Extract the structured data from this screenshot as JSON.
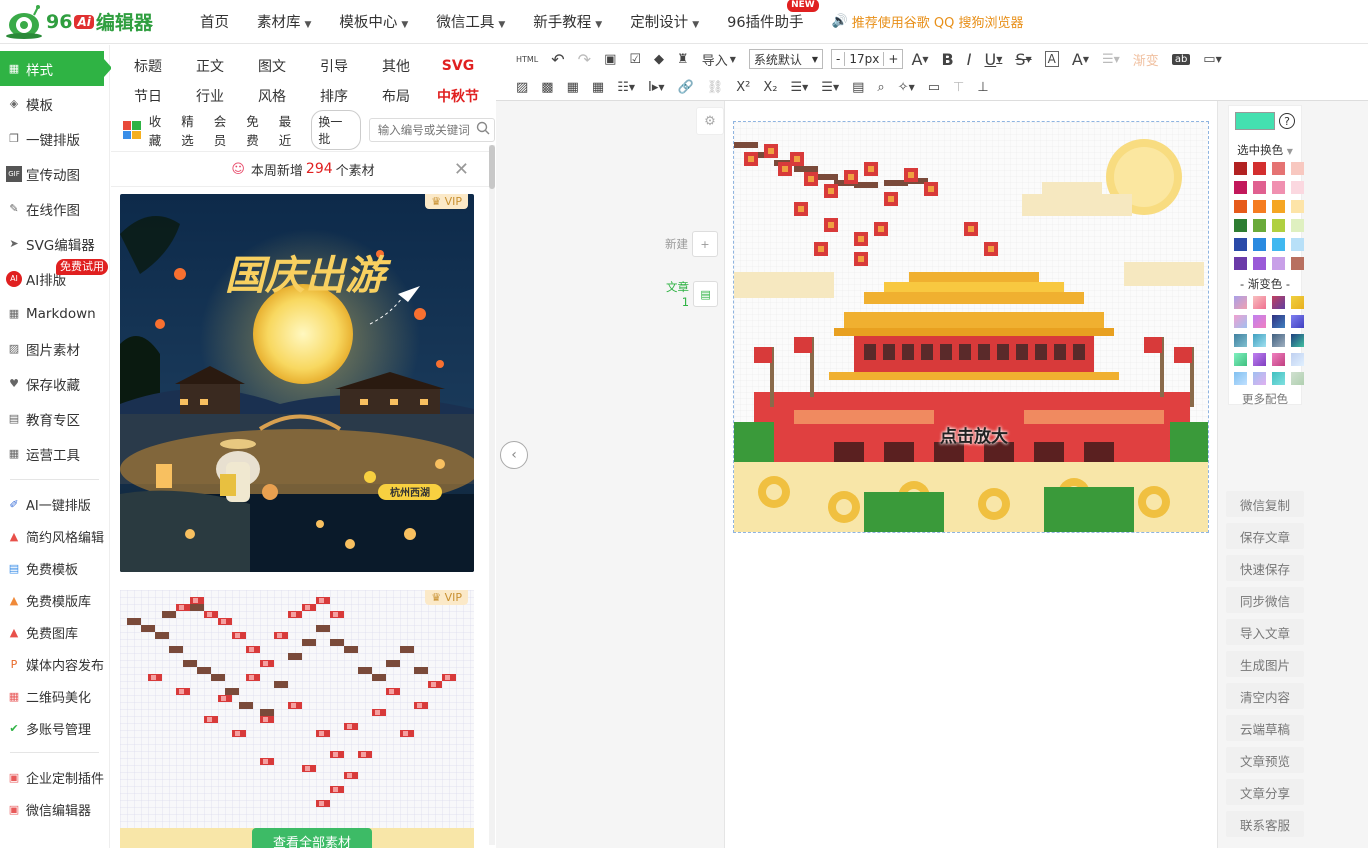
{
  "logo": {
    "prefix": "96",
    "ai": "Ai",
    "name": "编辑器"
  },
  "nav": {
    "items": [
      {
        "label": "首页",
        "caret": false
      },
      {
        "label": "素材库",
        "caret": true
      },
      {
        "label": "模板中心",
        "caret": true
      },
      {
        "label": "微信工具",
        "caret": true
      },
      {
        "label": "新手教程",
        "caret": true
      },
      {
        "label": "定制设计",
        "caret": true
      },
      {
        "label": "96插件助手",
        "caret": false
      }
    ],
    "new_badge": "NEW",
    "promo": "推荐使用谷歌 QQ 搜狗浏览器"
  },
  "sidebar": {
    "items": [
      {
        "label": "样式",
        "icon": "grid-icon",
        "active": true
      },
      {
        "label": "模板",
        "icon": "layers-icon"
      },
      {
        "label": "一键排版",
        "icon": "copy-icon"
      },
      {
        "label": "宣传动图",
        "icon": "gif-icon"
      },
      {
        "label": "在线作图",
        "icon": "edit-icon"
      },
      {
        "label": "SVG编辑器",
        "icon": "cursor-icon"
      },
      {
        "label": "AI排版",
        "icon": "ai-icon",
        "badge": "免费试用"
      },
      {
        "label": "Markdown",
        "icon": "grid-icon"
      },
      {
        "label": "图片素材",
        "icon": "image-icon"
      },
      {
        "label": "保存收藏",
        "icon": "heart-icon"
      },
      {
        "label": "教育专区",
        "icon": "book-icon"
      },
      {
        "label": "运营工具",
        "icon": "grid-icon"
      }
    ],
    "tools": [
      {
        "label": "AI一键排版",
        "icon": "ai-brush-icon",
        "color": "#3a6fd8"
      },
      {
        "label": "简约风格编辑",
        "icon": "picture-icon",
        "color": "#e8504a"
      },
      {
        "label": "免费模板",
        "icon": "doc-icon",
        "color": "#3a8ee8"
      },
      {
        "label": "免费模版库",
        "icon": "picture-icon",
        "color": "#f08a3a"
      },
      {
        "label": "免费图库",
        "icon": "picture-icon",
        "color": "#e8504a"
      },
      {
        "label": "媒体内容发布",
        "icon": "ppt-icon",
        "color": "#e86a2a"
      },
      {
        "label": "二维码美化",
        "icon": "qr-icon",
        "color": "#e85a5a"
      },
      {
        "label": "多账号管理",
        "icon": "check-icon",
        "color": "#2fb344"
      }
    ],
    "plugins": [
      {
        "label": "企业定制插件",
        "icon": "plugin-icon",
        "color": "#e85a5a"
      },
      {
        "label": "微信编辑器",
        "icon": "plugin-icon",
        "color": "#e85a5a"
      }
    ]
  },
  "panel": {
    "categories": [
      {
        "label": "标题"
      },
      {
        "label": "正文"
      },
      {
        "label": "图文"
      },
      {
        "label": "引导"
      },
      {
        "label": "其他"
      },
      {
        "label": "SVG",
        "red": true
      },
      {
        "label": "节日"
      },
      {
        "label": "行业"
      },
      {
        "label": "风格"
      },
      {
        "label": "排序"
      },
      {
        "label": "布局"
      },
      {
        "label": "中秋节",
        "red": true
      }
    ],
    "filters": [
      "收藏",
      "精选",
      "会员",
      "免费",
      "最近"
    ],
    "swap_label": "换一批",
    "search_placeholder": "输入编号或关键词",
    "notice": {
      "prefix": "本周新增",
      "count": "294",
      "suffix": "个素材"
    },
    "card1": {
      "vip": "VIP",
      "title": "国庆出游",
      "location": "杭州西湖"
    },
    "card2": {
      "vip": "VIP",
      "button": "查看全部素材"
    }
  },
  "toolbar": {
    "row1": [
      "HTML",
      "↶",
      "↷",
      "📄",
      "☑",
      "◆",
      "♜",
      "导入",
      "系统默认",
      "-",
      "17px",
      "+",
      "A",
      "B",
      "I",
      "U",
      "S",
      "A",
      "A",
      "☰",
      "渐变",
      "ab",
      "▭"
    ],
    "import": "导入",
    "font": "系统默认",
    "size": "17px",
    "gradient": "渐变"
  },
  "editor": {
    "new_label": "新建",
    "article_label": "文章1",
    "zoom_label": "点击放大"
  },
  "colors": {
    "current": "#44e0b0",
    "select_label": "选中换色",
    "gradient_label": "- 渐变色 -",
    "more_label": "更多配色",
    "solid": [
      "#b22222",
      "#d32f2f",
      "#e57373",
      "#f8c8c0",
      "#c2185b",
      "#e06090",
      "#f090b0",
      "#fbd8e0",
      "#e65a1a",
      "#f57c20",
      "#f5a623",
      "#fde4a8",
      "#2e7d32",
      "#6aaa3a",
      "#b0d040",
      "#dff0c0",
      "#2a4aa8",
      "#2a8ae0",
      "#40b8f0",
      "#b8e0f8",
      "#6a3aa8",
      "#9a5ad8",
      "#c8a0e8",
      "#b87060"
    ],
    "gradients": [
      [
        "#a8a0e8",
        "#f0a0b0"
      ],
      [
        "#f8c0c0",
        "#f07090"
      ],
      [
        "#c04060",
        "#6040a0"
      ],
      [
        "#f0d040",
        "#e8b020"
      ],
      [
        "#f0a0d0",
        "#a0c0f0"
      ],
      [
        "#c080f0",
        "#f080c0"
      ],
      [
        "#303080",
        "#4080c0"
      ],
      [
        "#8080f0",
        "#4040c0"
      ],
      [
        "#4080a0",
        "#80c0d0"
      ],
      [
        "#40a0c0",
        "#a0e0f0"
      ],
      [
        "#406080",
        "#a0b0c0"
      ],
      [
        "#204080",
        "#40c0a0"
      ],
      [
        "#80f0c0",
        "#40c080"
      ],
      [
        "#c080f0",
        "#8040c0"
      ],
      [
        "#f080c0",
        "#c04080"
      ],
      [
        "#c0d0f0",
        "#e0f0ff"
      ],
      [
        "#80c0f0",
        "#c0e0ff"
      ],
      [
        "#a0c0f0",
        "#e0b0f0"
      ],
      [
        "#40c0c0",
        "#80e0e0"
      ],
      [
        "#d0e0d0",
        "#b0d0b0"
      ]
    ]
  },
  "actions": [
    "微信复制",
    "保存文章",
    "快速保存",
    "同步微信",
    "导入文章",
    "生成图片",
    "清空内容",
    "云端草稿",
    "文章预览",
    "文章分享",
    "联系客服"
  ]
}
